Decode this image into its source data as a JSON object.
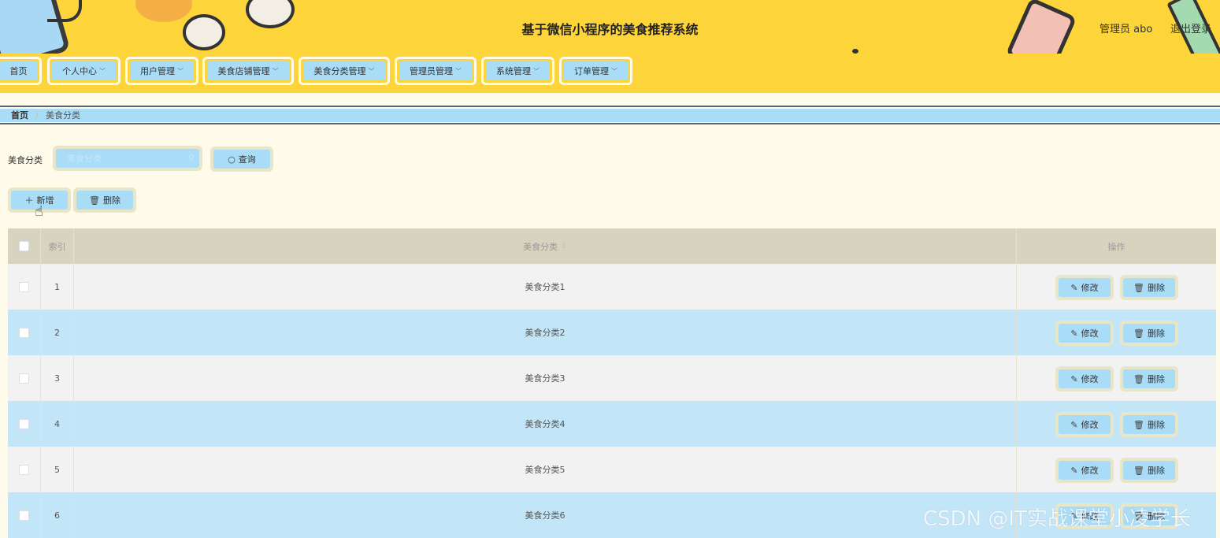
{
  "header": {
    "title": "基于微信小程序的美食推荐系统",
    "user": "管理员 abo",
    "logout": "退出登录"
  },
  "nav": [
    {
      "label": "首页",
      "dropdown": false
    },
    {
      "label": "个人中心",
      "dropdown": true
    },
    {
      "label": "用户管理",
      "dropdown": true
    },
    {
      "label": "美食店铺管理",
      "dropdown": true
    },
    {
      "label": "美食分类管理",
      "dropdown": true
    },
    {
      "label": "管理员管理",
      "dropdown": true
    },
    {
      "label": "系统管理",
      "dropdown": true
    },
    {
      "label": "订单管理",
      "dropdown": true
    }
  ],
  "breadcrumb": {
    "home": "首页",
    "separator": "/",
    "current": "美食分类"
  },
  "search": {
    "label": "美食分类",
    "placeholder": "美食分类",
    "value": "",
    "button": "查询"
  },
  "actions": {
    "add": "新增",
    "delete": "删除"
  },
  "table": {
    "headers": {
      "index": "索引",
      "name": "美食分类",
      "ops": "操作"
    },
    "rows": [
      {
        "index": "1",
        "name": "美食分类1"
      },
      {
        "index": "2",
        "name": "美食分类2"
      },
      {
        "index": "3",
        "name": "美食分类3"
      },
      {
        "index": "4",
        "name": "美食分类4"
      },
      {
        "index": "5",
        "name": "美食分类5"
      },
      {
        "index": "6",
        "name": "美食分类6"
      }
    ],
    "edit_label": "修改",
    "delete_label": "删除"
  },
  "watermark": "CSDN @IT实战课堂小凌学长",
  "colors": {
    "header_bg": "#fdd43a",
    "button_bg": "#a8dcf7",
    "row_alt": "#c3e5f8",
    "page_bg": "#fffbea"
  }
}
